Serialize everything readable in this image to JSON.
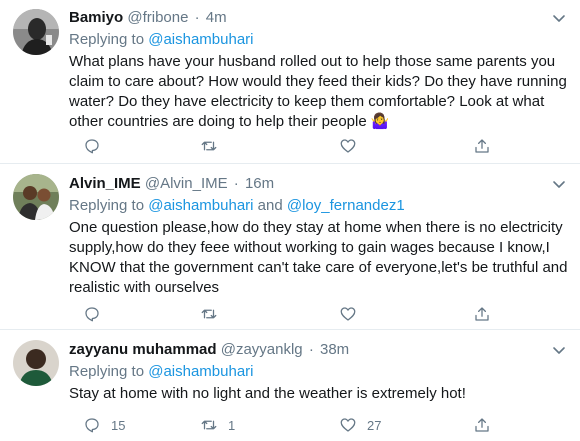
{
  "tweets": [
    {
      "name": "Bamiyo",
      "handle": "@fribone",
      "sep": "·",
      "time": "4m",
      "replying_prefix": "Replying to ",
      "replying_to": [
        "@aishambuhari"
      ],
      "replying_joiner": "",
      "text": "What plans have your husband rolled out to help those same parents you claim to care about? How would they feed their kids? Do they have running water? Do they have electricity to keep them comfortable? Look at what other countries are doing to help their people",
      "emoji": "🤷‍♀️",
      "counts": {
        "reply": "",
        "retweet": "",
        "like": ""
      }
    },
    {
      "name": "Alvin_IME",
      "handle": "@Alvin_IME",
      "sep": "·",
      "time": "16m",
      "replying_prefix": "Replying to ",
      "replying_to": [
        "@aishambuhari",
        "@loy_fernandez1"
      ],
      "replying_joiner": " and ",
      "text": "One question please,how do they stay at home when there is no electricity supply,how do they feee without working to gain wages because I know,I KNOW that the government can't take care of everyone,let's be truthful and realistic with ourselves",
      "emoji": "",
      "counts": {
        "reply": "",
        "retweet": "",
        "like": ""
      }
    },
    {
      "name": "zayyanu muhammad",
      "handle": "@zayyanklg",
      "sep": "·",
      "time": "38m",
      "replying_prefix": "Replying to ",
      "replying_to": [
        "@aishambuhari"
      ],
      "replying_joiner": "",
      "text": "Stay at home with no light and the weather is extremely hot!",
      "emoji": "",
      "counts": {
        "reply": "15",
        "retweet": "1",
        "like": "27"
      }
    }
  ],
  "icons": {
    "reply": "reply-icon",
    "retweet": "retweet-icon",
    "like": "heart-icon",
    "share": "share-icon",
    "more": "chevron-down-icon"
  },
  "colors": {
    "link": "#1b95e0",
    "secondary": "#657786",
    "text": "#14171a",
    "divider": "#e6ecf0"
  }
}
